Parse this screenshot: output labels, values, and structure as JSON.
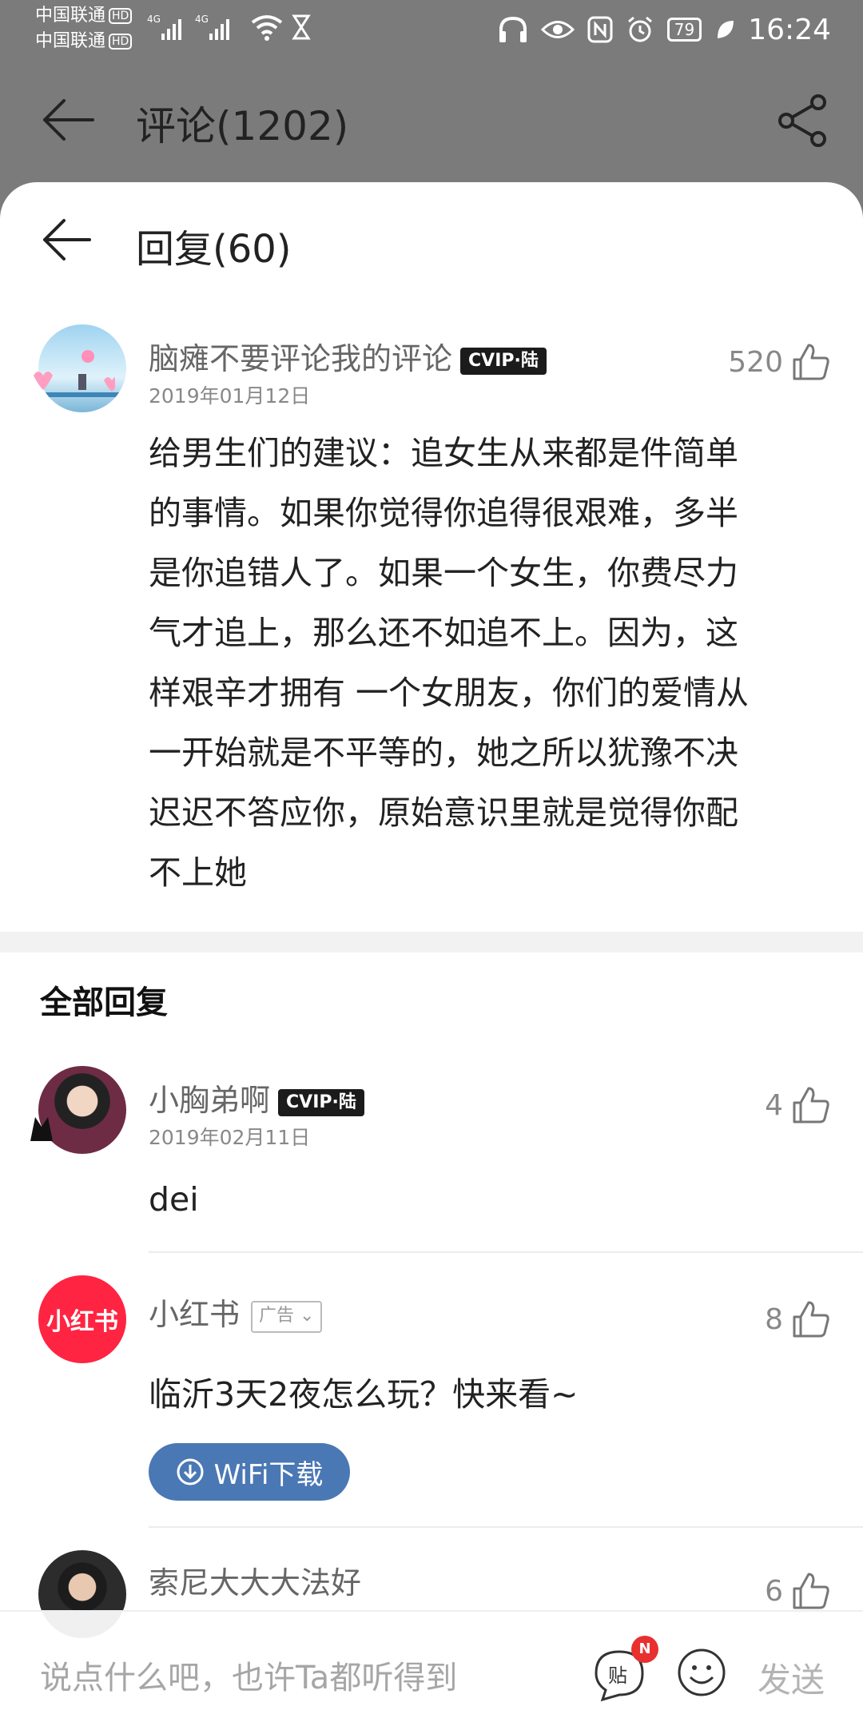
{
  "status": {
    "carrier1": "中国联通",
    "carrier2": "中国联通",
    "hd": "HD",
    "net1": "4G",
    "net2": "4G",
    "battery": "79",
    "time": "16:24"
  },
  "header": {
    "title": "评论(1202)"
  },
  "sheet": {
    "title": "回复(60)"
  },
  "main_comment": {
    "username": "脑瘫不要评论我的评论",
    "vip": "CVIP·陆",
    "date": "2019年01月12日",
    "likes": "520",
    "lines": [
      "给男生们的建议：追女生从来都是件简单",
      "的事情。如果你觉得你追得很艰难，多半",
      "是你追错人了。如果一个女生，你费尽力",
      "气才追上，那么还不如追不上。因为，这",
      "样艰辛才拥有 一个女朋友，你们的爱情从",
      "一开始就是不平等的，她之所以犹豫不决",
      "迟迟不答应你，原始意识里就是觉得你配",
      "不上她"
    ]
  },
  "replies_section": {
    "title": "全部回复"
  },
  "replies": [
    {
      "username": "小胸弟啊",
      "vip": "CVIP·陆",
      "date": "2019年02月11日",
      "likes": "4",
      "text": "dei"
    },
    {
      "username": "小红书",
      "ad_tag": "广告",
      "logo_text": "小红书",
      "likes": "8",
      "text": "临沂3天2夜怎么玩？快来看~",
      "button": "WiFi下载"
    },
    {
      "username": "索尼大大大法好",
      "likes": "6"
    }
  ],
  "input": {
    "placeholder": "说点什么吧，也许Ta都听得到",
    "tie_label": "贴",
    "badge": "N",
    "send": "发送"
  }
}
